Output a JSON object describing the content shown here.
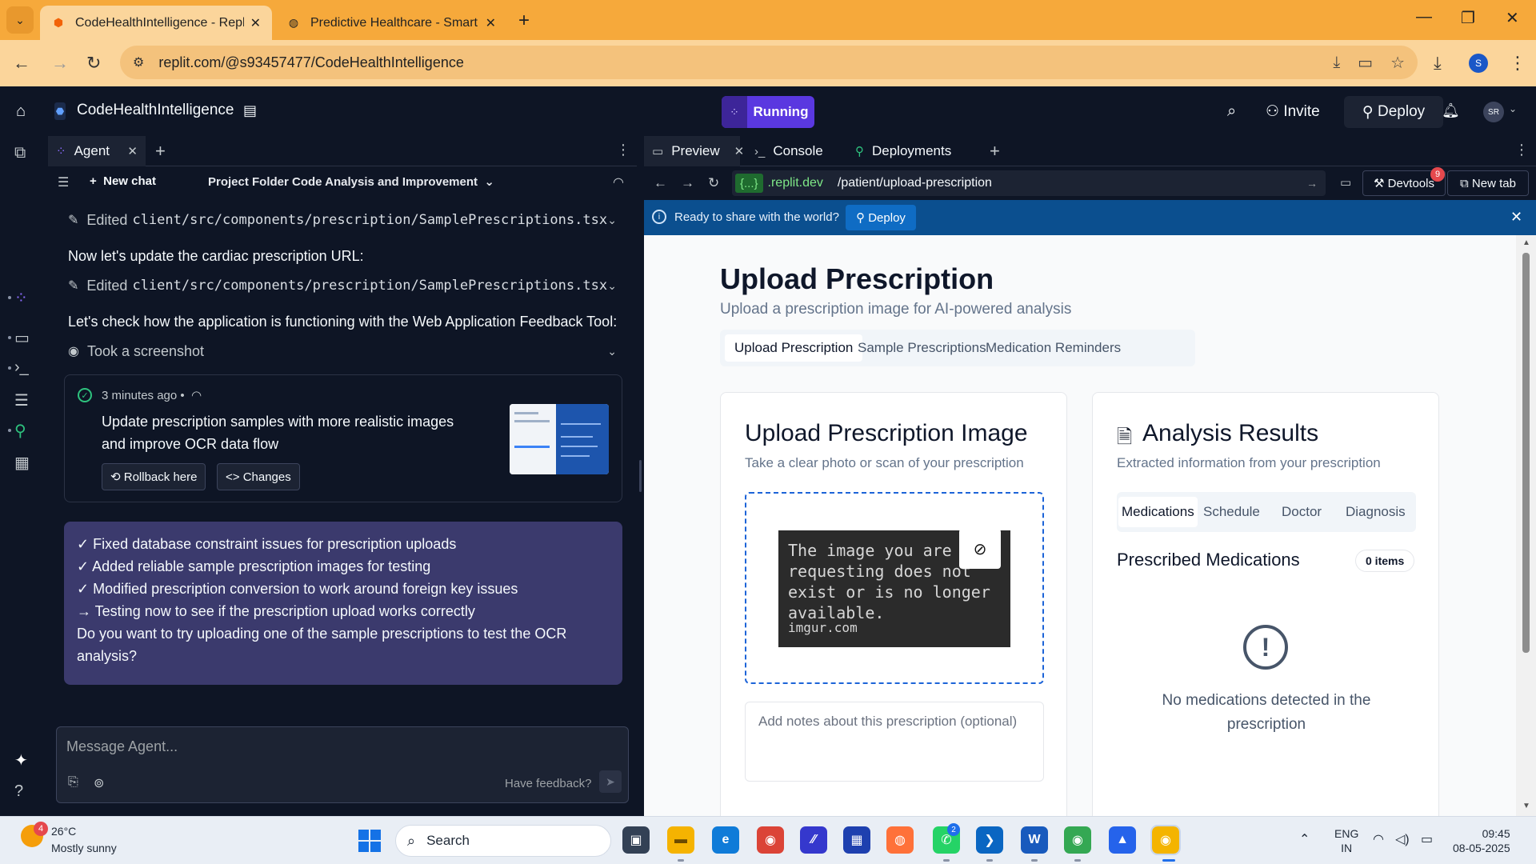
{
  "browser": {
    "tabs": [
      {
        "title": "CodeHealthIntelligence - Replit",
        "active": true
      },
      {
        "title": "Predictive Healthcare - Smart H",
        "active": false
      }
    ],
    "url": "replit.com/@s93457477/CodeHealthIntelligence",
    "profile_initial": "S"
  },
  "replit": {
    "project_name": "CodeHealthIntelligence",
    "run_status": "Running",
    "invite_label": "Invite",
    "deploy_label": "Deploy",
    "avatar_initials": "SR"
  },
  "agent": {
    "tab_label": "Agent",
    "new_chat_label": "New chat",
    "chat_title": "Project Folder Code Analysis and Improvement",
    "edited_label": "Edited",
    "edited_file": "client/src/components/prescription/SamplePrescriptions.tsx",
    "note_cardiac": "Now let's update the cardiac prescription URL:",
    "note_check": "Let's check how the application is functioning with the Web Application Feedback Tool:",
    "screenshot_label": "Took a screenshot",
    "checkpoint": {
      "time": "3 minutes ago",
      "separator": "•",
      "description": "Update prescription samples with more realistic images and improve OCR data flow",
      "rollback_label": "Rollback here",
      "changes_label": "Changes"
    },
    "summary_lines": [
      "✓ Fixed database constraint issues for prescription uploads",
      "✓ Added reliable sample prescription images for testing",
      "✓ Modified prescription conversion to work around foreign key issues",
      "→ Testing now to see if the prescription upload works correctly",
      "Do you want to try uploading one of the sample prescriptions to test the OCR analysis?"
    ],
    "message_placeholder": "Message Agent...",
    "feedback_label": "Have feedback?"
  },
  "preview": {
    "tabs": [
      {
        "label": "Preview",
        "icon": "monitor-icon"
      },
      {
        "label": "Console",
        "icon": "terminal-icon"
      },
      {
        "label": "Deployments",
        "icon": "deploy-icon"
      }
    ],
    "domain_chip": "{...}",
    "domain": ".replit.dev",
    "path": "/patient/upload-prescription",
    "devtools_label": "Devtools",
    "devtools_badge": "9",
    "newtab_label": "New tab",
    "banner_text": "Ready to share with the world?",
    "banner_deploy": "Deploy"
  },
  "page": {
    "title": "Upload Prescription",
    "subtitle": "Upload a prescription image for AI-powered analysis",
    "tabs": [
      "Upload Prescription",
      "Sample Prescriptions",
      "Medication Reminders"
    ],
    "upload_card": {
      "title": "Upload Prescription Image",
      "description": "Take a clear photo or scan of your prescription",
      "image_text": "The image you are requesting does not exist or is no longer available.",
      "image_source": "imgur.com",
      "notes_placeholder": "Add notes about this prescription (optional)"
    },
    "results_card": {
      "title": "Analysis Results",
      "description": "Extracted information from your prescription",
      "tabs": [
        "Medications",
        "Schedule",
        "Doctor",
        "Diagnosis"
      ],
      "section_title": "Prescribed Medications",
      "items_badge": "0 items",
      "empty_text": "No medications detected in the prescription"
    }
  },
  "taskbar": {
    "temperature": "26°C",
    "condition": "Mostly sunny",
    "weather_badge": "4",
    "search_label": "Search",
    "lang_top": "ENG",
    "lang_bottom": "IN",
    "time": "09:45",
    "date": "08-05-2025"
  },
  "colors": {
    "accent": "#5a38e0",
    "banner": "#0b4f8f",
    "dropzone": "#1d64d8",
    "browser_frame": "#f6a93b"
  }
}
